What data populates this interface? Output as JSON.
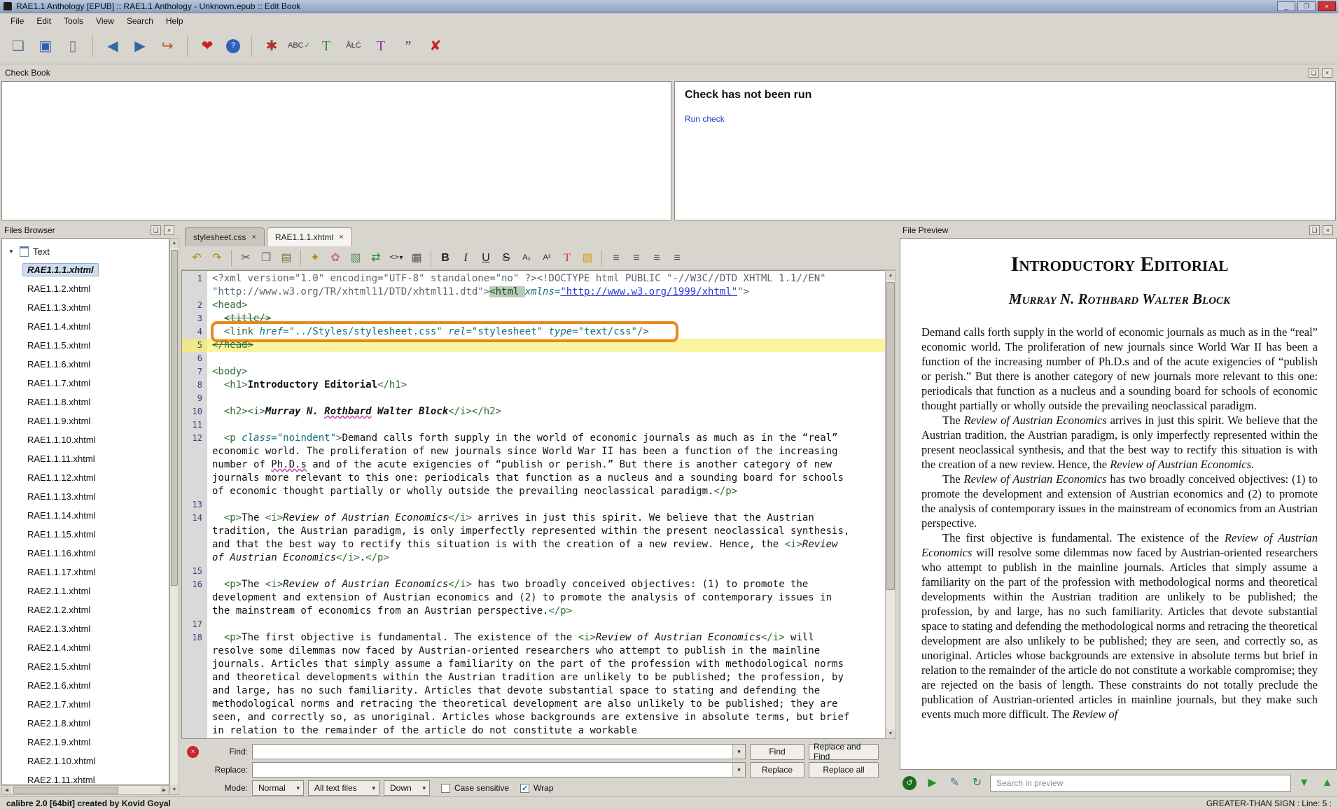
{
  "window": {
    "title": "RAE1.1 Anthology [EPUB] :: RAE1.1 Anthology - Unknown.epub :: Edit Book"
  },
  "glyphs": {
    "float": "❏",
    "close": "×",
    "dropdown": "▾",
    "check": "✓",
    "minimize": "_",
    "maximize": "❐",
    "scroll_up": "▲",
    "scroll_down": "▼",
    "scroll_left": "◀",
    "scroll_right": "▶",
    "tree_expanded": "▼"
  },
  "colors": {
    "accent_orange": "#e8891c",
    "current_line_yellow": "#faf4a0",
    "link_blue": "#1540c8",
    "tag_green": "#2e6b30",
    "attr_teal": "#11707a"
  },
  "menu_bar": {
    "items": [
      "File",
      "Edit",
      "Tools",
      "View",
      "Search",
      "Help"
    ]
  },
  "main_toolbar": {
    "icons": [
      {
        "name": "add-file-icon",
        "glyph": "❏",
        "color": "#5b7a9d"
      },
      {
        "name": "save-icon",
        "glyph": "▣",
        "color": "#2f5fb0"
      },
      {
        "name": "book-icon",
        "glyph": "▯",
        "color": "#777777"
      },
      {
        "sep": true
      },
      {
        "name": "back-icon",
        "glyph": "◀",
        "color": "#3465a4"
      },
      {
        "name": "forward-icon",
        "glyph": "▶",
        "color": "#3465a4"
      },
      {
        "name": "jump-icon",
        "glyph": "↪",
        "color": "#c0571f"
      },
      {
        "sep": true
      },
      {
        "name": "donate-icon",
        "glyph": "❤",
        "color": "#cc2222"
      },
      {
        "name": "help-icon",
        "glyph": "?",
        "color": "#ffffff",
        "bg": "#2e62b8",
        "round": true,
        "small": true
      },
      {
        "sep": true
      },
      {
        "name": "check-book-icon",
        "glyph": "✱",
        "color": "#b03030"
      },
      {
        "name": "spell-check-icon",
        "glyph": "ABC",
        "color": "#333333",
        "small": true,
        "sub": "✓",
        "subcolor": "#2a9a2a"
      },
      {
        "name": "insert-special-character-icon",
        "glyph": "T",
        "color": "#2a8f2a",
        "serif": true
      },
      {
        "name": "change-case-icon",
        "glyph": "ÅŁĆ",
        "color": "#333333",
        "small": true
      },
      {
        "name": "fix-html-icon",
        "glyph": "T",
        "color": "#8a2fb0",
        "serif": true
      },
      {
        "name": "smarten-punctuation-icon",
        "glyph": "”",
        "color": "#444444",
        "serif": true
      },
      {
        "name": "remove-unused-css-icon",
        "glyph": "✘",
        "color": "#cc2222"
      }
    ]
  },
  "check_book": {
    "panel_title": "Check Book",
    "message": "Check has not been run",
    "run_check_label": "Run check"
  },
  "files_browser": {
    "panel_title": "Files Browser",
    "category_label": "Text",
    "selected_file": "RAE1.1.1.xhtml",
    "files": [
      "RAE1.1.1.xhtml",
      "RAE1.1.2.xhtml",
      "RAE1.1.3.xhtml",
      "RAE1.1.4.xhtml",
      "RAE1.1.5.xhtml",
      "RAE1.1.6.xhtml",
      "RAE1.1.7.xhtml",
      "RAE1.1.8.xhtml",
      "RAE1.1.9.xhtml",
      "RAE1.1.10.xhtml",
      "RAE1.1.11.xhtml",
      "RAE1.1.12.xhtml",
      "RAE1.1.13.xhtml",
      "RAE1.1.14.xhtml",
      "RAE1.1.15.xhtml",
      "RAE1.1.16.xhtml",
      "RAE1.1.17.xhtml",
      "RAE2.1.1.xhtml",
      "RAE2.1.2.xhtml",
      "RAE2.1.3.xhtml",
      "RAE2.1.4.xhtml",
      "RAE2.1.5.xhtml",
      "RAE2.1.6.xhtml",
      "RAE2.1.7.xhtml",
      "RAE2.1.8.xhtml",
      "RAE2.1.9.xhtml",
      "RAE2.1.10.xhtml",
      "RAE2.1.11.xhtml"
    ]
  },
  "editor": {
    "tabs": [
      {
        "label": "stylesheet.css",
        "active": false
      },
      {
        "label": "RAE1.1.1.xhtml",
        "active": true
      }
    ],
    "toolbar_icons": [
      {
        "name": "undo-icon",
        "glyph": "↶",
        "color": "#b58900"
      },
      {
        "name": "redo-icon",
        "glyph": "↷",
        "color": "#b58900"
      },
      {
        "sep": true
      },
      {
        "name": "cut-icon",
        "glyph": "✂",
        "color": "#555555"
      },
      {
        "name": "copy-icon",
        "glyph": "❐",
        "color": "#666666"
      },
      {
        "name": "paste-icon",
        "glyph": "▤",
        "color": "#8a6a3a"
      },
      {
        "sep": true
      },
      {
        "name": "bee-icon",
        "glyph": "✦",
        "color": "#b8860b"
      },
      {
        "name": "flower-icon",
        "glyph": "✿",
        "color": "#cc66aa"
      },
      {
        "name": "insert-image-icon",
        "glyph": "▧",
        "color": "#5a8a5a"
      },
      {
        "name": "arrows-icon",
        "glyph": "⇄",
        "color": "#2a8f2a"
      },
      {
        "name": "insert-tag-icon",
        "glyph": "<>",
        "color": "#222222",
        "small": true,
        "sub": "▾",
        "subcolor": "#222222"
      },
      {
        "name": "insert-table-icon",
        "glyph": "▦",
        "color": "#555555"
      },
      {
        "sep": true
      },
      {
        "name": "bold-icon",
        "glyph": "B",
        "color": "#222222",
        "bold": true
      },
      {
        "name": "italic-icon",
        "glyph": "I",
        "color": "#222222",
        "italic": true,
        "serif": true
      },
      {
        "name": "underline-icon",
        "glyph": "U",
        "color": "#222222",
        "underline": true
      },
      {
        "name": "strikethrough-icon",
        "glyph": "S",
        "color": "#222222",
        "strike": true
      },
      {
        "name": "subscript-icon",
        "glyph": "A₂",
        "color": "#222222",
        "small": true
      },
      {
        "name": "superscript-icon",
        "glyph": "A²",
        "color": "#222222",
        "small": true
      },
      {
        "name": "text-color-icon",
        "glyph": "T",
        "color": "#cc3333",
        "serif": true
      },
      {
        "name": "fill-color-icon",
        "glyph": "▨",
        "color": "#d4a017"
      },
      {
        "sep": true
      },
      {
        "name": "align-left-icon",
        "glyph": "≡",
        "color": "#444444"
      },
      {
        "name": "align-center-icon",
        "glyph": "≡",
        "color": "#444444"
      },
      {
        "name": "align-right-icon",
        "glyph": "≡",
        "color": "#444444"
      },
      {
        "name": "align-justify-icon",
        "glyph": "≡",
        "color": "#444444"
      }
    ],
    "current_line": 5,
    "lines": [
      {
        "n": 1,
        "tokens": [
          [
            "pre",
            "<?xml version=\"1.0\" encoding=\"UTF-8\" standalone=\"no\" ?><!DOCTYPE html PUBLIC \"-//W3C//DTD XHTML 1.1//EN\" \"http://www.w3.org/TR/xhtml11/DTD/xhtml11.dtd\">"
          ],
          [
            "taghl",
            "<html "
          ],
          [
            "attr",
            "xmlns="
          ],
          [
            "url",
            "\"http://www.w3.org/1999/xhtml\""
          ],
          [
            "tag",
            "\">"
          ]
        ]
      },
      {
        "n": 2,
        "tokens": [
          [
            "tag",
            "<head>"
          ]
        ]
      },
      {
        "n": 3,
        "tokens": [
          [
            "txt",
            "  "
          ],
          [
            "tagx",
            "<title/>"
          ]
        ]
      },
      {
        "n": 4,
        "boxed": true,
        "tokens": [
          [
            "txt",
            "  "
          ],
          [
            "tag",
            "<link "
          ],
          [
            "attr",
            "href="
          ],
          [
            "val",
            "\"../Styles/stylesheet.css\""
          ],
          [
            "txt",
            " "
          ],
          [
            "attr",
            "rel="
          ],
          [
            "val",
            "\"stylesheet\""
          ],
          [
            "txt",
            " "
          ],
          [
            "attr",
            "type="
          ],
          [
            "val",
            "\"text/css\""
          ],
          [
            "tag",
            "/>"
          ]
        ]
      },
      {
        "n": 5,
        "current": true,
        "tokens": [
          [
            "tagx",
            "</head>"
          ]
        ]
      },
      {
        "n": 6,
        "tokens": []
      },
      {
        "n": 7,
        "tokens": [
          [
            "tag",
            "<body>"
          ]
        ]
      },
      {
        "n": 8,
        "tokens": [
          [
            "txt",
            "  "
          ],
          [
            "tag",
            "<h1>"
          ],
          [
            "b",
            "Introductory Editorial"
          ],
          [
            "tag",
            "</h1>"
          ]
        ]
      },
      {
        "n": 9,
        "tokens": []
      },
      {
        "n": 10,
        "tokens": [
          [
            "txt",
            "  "
          ],
          [
            "tag",
            "<h2><i>"
          ],
          [
            "bi",
            "Murray N. "
          ],
          [
            "bisp",
            "Rothbard"
          ],
          [
            "bi",
            " Walter Block"
          ],
          [
            "tag",
            "</i></h2>"
          ]
        ]
      },
      {
        "n": 11,
        "tokens": []
      },
      {
        "n": 12,
        "tokens": [
          [
            "txt",
            "  "
          ],
          [
            "tag",
            "<p "
          ],
          [
            "attr",
            "class="
          ],
          [
            "val",
            "\"noindent\""
          ],
          [
            "tag",
            ">"
          ],
          [
            "txt",
            "Demand calls forth supply in the world of economic journals as much as in the “real” economic world. The proliferation of new journals since World War II has been a function of the increasing number of "
          ],
          [
            "sp",
            "Ph.D.s"
          ],
          [
            "txt",
            " and of the acute exigencies of “publish or perish.” But there is another category of new journals more relevant to this one: periodicals that function as a nucleus and a sounding board for schools of economic thought partially or wholly outside the prevailing neoclassical paradigm."
          ],
          [
            "tag",
            "</p>"
          ]
        ]
      },
      {
        "n": 13,
        "tokens": []
      },
      {
        "n": 14,
        "tokens": [
          [
            "txt",
            "  "
          ],
          [
            "tag",
            "<p>"
          ],
          [
            "txt",
            "The "
          ],
          [
            "tag",
            "<i>"
          ],
          [
            "i",
            "Review of Austrian Economics"
          ],
          [
            "tag",
            "</i>"
          ],
          [
            "txt",
            " arrives in just this spirit. We believe that the Austrian tradition, the Austrian paradigm, is only imperfectly represented within the present neoclassical synthesis, and that the best way to rectify this situation is with the creation of a new review. Hence, the "
          ],
          [
            "tag",
            "<i>"
          ],
          [
            "i",
            "Review of Austrian Economics"
          ],
          [
            "tag",
            "</i>"
          ],
          [
            "txt",
            "."
          ],
          [
            "tag",
            "</p>"
          ]
        ]
      },
      {
        "n": 15,
        "tokens": []
      },
      {
        "n": 16,
        "tokens": [
          [
            "txt",
            "  "
          ],
          [
            "tag",
            "<p>"
          ],
          [
            "txt",
            "The "
          ],
          [
            "tag",
            "<i>"
          ],
          [
            "i",
            "Review of Austrian Economics"
          ],
          [
            "tag",
            "</i>"
          ],
          [
            "txt",
            " has two broadly conceived objectives: (1) to promote the development and extension of Austrian economics and (2) to promote the analysis of contemporary issues in the mainstream of economics from an Austrian perspective."
          ],
          [
            "tag",
            "</p>"
          ]
        ]
      },
      {
        "n": 17,
        "tokens": []
      },
      {
        "n": 18,
        "tokens": [
          [
            "txt",
            "  "
          ],
          [
            "tag",
            "<p>"
          ],
          [
            "txt",
            "The first objective is fundamental. The existence of the "
          ],
          [
            "tag",
            "<i>"
          ],
          [
            "i",
            "Review of Austrian Economics"
          ],
          [
            "tag",
            "</i>"
          ],
          [
            "txt",
            " will resolve some dilemmas now faced by Austrian-oriented researchers who attempt to publish in the mainline journals. Articles that simply assume a familiarity on the part of the profession with methodological norms and theoretical developments within the Austrian tradition are unlikely to be published; the profession, by and large, has no such familiarity. Articles that devote substantial space to stating and defending the methodological norms and retracing the theoretical development are also unlikely to be published; they are seen, and correctly so, as unoriginal. Articles whose backgrounds are extensive in absolute terms, but brief in relation to the remainder of the article do not constitute a workable"
          ]
        ]
      }
    ]
  },
  "find_replace": {
    "find_label": "Find:",
    "replace_label": "Replace:",
    "mode_label": "Mode:",
    "find_value": "",
    "replace_value": "",
    "find_button": "Find",
    "replace_and_find_button": "Replace and Find",
    "replace_button": "Replace",
    "replace_all_button": "Replace all",
    "mode_value": "Normal",
    "scope_value": "All text files",
    "direction_value": "Down",
    "case_sensitive_label": "Case sensitive",
    "case_sensitive_checked": false,
    "wrap_label": "Wrap",
    "wrap_checked": true
  },
  "preview": {
    "panel_title": "File Preview",
    "heading": "Introductory Editorial",
    "subheading": "Murray N. Rothbard Walter Block",
    "paragraphs": [
      {
        "indent": false,
        "segments": [
          [
            "n",
            "Demand calls forth supply in the world of economic journals as much as in the “real” economic world. The proliferation of new journals since World War II has been a function of the increasing number of Ph.D.s and of the acute exigencies of “publish or perish.” But there is another category of new journals more relevant to this one: periodicals that function as a nucleus and a sounding board for schools of economic thought partially or wholly outside the prevailing neoclassical paradigm."
          ]
        ]
      },
      {
        "indent": true,
        "segments": [
          [
            "n",
            "The "
          ],
          [
            "i",
            "Review of Austrian Economics"
          ],
          [
            "n",
            " arrives in just this spirit. We believe that the Austrian tradition, the Austrian paradigm, is only imperfectly represented within the present neoclassical synthesis, and that the best way to rectify this situation is with the creation of a new review. Hence, the "
          ],
          [
            "i",
            "Review of Austrian Economics"
          ],
          [
            "n",
            "."
          ]
        ]
      },
      {
        "indent": true,
        "segments": [
          [
            "n",
            "The "
          ],
          [
            "i",
            "Review of Austrian Economics"
          ],
          [
            "n",
            " has two broadly conceived objectives: (1) to promote the development and extension of Austrian economics and (2) to promote the analysis of contemporary issues in the mainstream of economics from an Austrian perspective."
          ]
        ]
      },
      {
        "indent": true,
        "segments": [
          [
            "n",
            "The first objective is fundamental. The existence of the "
          ],
          [
            "i",
            "Review of Austrian Economics"
          ],
          [
            "n",
            " will resolve some dilemmas now faced by Austrian-oriented researchers who attempt to publish in the mainline journals. Articles that simply assume a familiarity on the part of the profession with methodological norms and theoretical developments within the Austrian tradition are unlikely to be published; the profession, by and large, has no such familiarity. Articles that devote substantial space to stating and defending the methodological norms and retracing the theoretical development are also unlikely to be published; they are seen, and correctly so, as unoriginal. Articles whose backgrounds are extensive in absolute terms but brief in relation to the remainder of the article do not constitute a workable compromise; they are rejected on the basis of length. These constraints do not totally preclude the publication of Austrian-oriented articles in mainline journals, but they make such events much more difficult. The "
          ],
          [
            "i",
            "Review of"
          ]
        ]
      }
    ],
    "controls": [
      {
        "name": "auto-reload-icon",
        "glyph": "↺",
        "color": "#ffffff",
        "bg": "#1c6b1c",
        "round": true,
        "small": true
      },
      {
        "name": "run-preview-icon",
        "glyph": "▶",
        "color": "#2a8f2a"
      },
      {
        "name": "quill-icon",
        "glyph": "✎",
        "color": "#4a6fa5"
      },
      {
        "name": "refresh-preview-icon",
        "glyph": "↻",
        "color": "#2a8f2a"
      }
    ],
    "nav_icons": [
      {
        "name": "find-next-preview-icon",
        "glyph": "▼",
        "color": "#2a9a2a"
      },
      {
        "name": "find-prev-preview-icon",
        "glyph": "▲",
        "color": "#2a9a2a"
      }
    ],
    "search_placeholder": "Search in preview"
  },
  "status_bar": {
    "left": "calibre 2.0 [64bit] created by Kovid Goyal",
    "right": "GREATER-THAN SIGN : Line: 5 :"
  }
}
